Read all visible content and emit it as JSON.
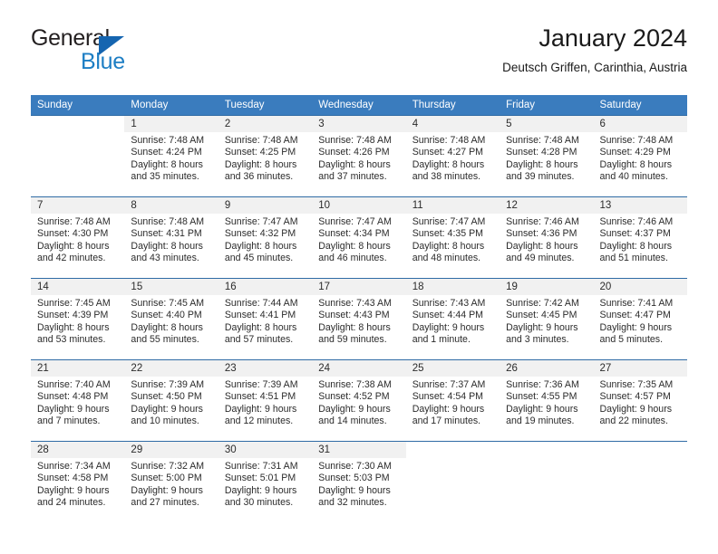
{
  "brand": {
    "name_top": "General",
    "name_bottom": "Blue",
    "triangle_color": "#1565b0",
    "blue_color": "#1d7ec4"
  },
  "header": {
    "title": "January 2024",
    "subtitle": "Deutsch Griffen, Carinthia, Austria"
  },
  "theme": {
    "header_bg": "#3a7cbe",
    "header_text": "#ffffff",
    "daynum_bg": "#f1f1f1",
    "row_border": "#2f6ba5",
    "body_text": "#2b2b2b"
  },
  "weekday_headers": [
    "Sunday",
    "Monday",
    "Tuesday",
    "Wednesday",
    "Thursday",
    "Friday",
    "Saturday"
  ],
  "labels": {
    "sunrise_prefix": "Sunrise: ",
    "sunset_prefix": "Sunset: ",
    "daylight_prefix": "Daylight: "
  },
  "weeks": [
    [
      {
        "day": "",
        "sunrise": "",
        "sunset": "",
        "daylight": ""
      },
      {
        "day": "1",
        "sunrise": "Sunrise: 7:48 AM",
        "sunset": "Sunset: 4:24 PM",
        "daylight": "Daylight: 8 hours and 35 minutes."
      },
      {
        "day": "2",
        "sunrise": "Sunrise: 7:48 AM",
        "sunset": "Sunset: 4:25 PM",
        "daylight": "Daylight: 8 hours and 36 minutes."
      },
      {
        "day": "3",
        "sunrise": "Sunrise: 7:48 AM",
        "sunset": "Sunset: 4:26 PM",
        "daylight": "Daylight: 8 hours and 37 minutes."
      },
      {
        "day": "4",
        "sunrise": "Sunrise: 7:48 AM",
        "sunset": "Sunset: 4:27 PM",
        "daylight": "Daylight: 8 hours and 38 minutes."
      },
      {
        "day": "5",
        "sunrise": "Sunrise: 7:48 AM",
        "sunset": "Sunset: 4:28 PM",
        "daylight": "Daylight: 8 hours and 39 minutes."
      },
      {
        "day": "6",
        "sunrise": "Sunrise: 7:48 AM",
        "sunset": "Sunset: 4:29 PM",
        "daylight": "Daylight: 8 hours and 40 minutes."
      }
    ],
    [
      {
        "day": "7",
        "sunrise": "Sunrise: 7:48 AM",
        "sunset": "Sunset: 4:30 PM",
        "daylight": "Daylight: 8 hours and 42 minutes."
      },
      {
        "day": "8",
        "sunrise": "Sunrise: 7:48 AM",
        "sunset": "Sunset: 4:31 PM",
        "daylight": "Daylight: 8 hours and 43 minutes."
      },
      {
        "day": "9",
        "sunrise": "Sunrise: 7:47 AM",
        "sunset": "Sunset: 4:32 PM",
        "daylight": "Daylight: 8 hours and 45 minutes."
      },
      {
        "day": "10",
        "sunrise": "Sunrise: 7:47 AM",
        "sunset": "Sunset: 4:34 PM",
        "daylight": "Daylight: 8 hours and 46 minutes."
      },
      {
        "day": "11",
        "sunrise": "Sunrise: 7:47 AM",
        "sunset": "Sunset: 4:35 PM",
        "daylight": "Daylight: 8 hours and 48 minutes."
      },
      {
        "day": "12",
        "sunrise": "Sunrise: 7:46 AM",
        "sunset": "Sunset: 4:36 PM",
        "daylight": "Daylight: 8 hours and 49 minutes."
      },
      {
        "day": "13",
        "sunrise": "Sunrise: 7:46 AM",
        "sunset": "Sunset: 4:37 PM",
        "daylight": "Daylight: 8 hours and 51 minutes."
      }
    ],
    [
      {
        "day": "14",
        "sunrise": "Sunrise: 7:45 AM",
        "sunset": "Sunset: 4:39 PM",
        "daylight": "Daylight: 8 hours and 53 minutes."
      },
      {
        "day": "15",
        "sunrise": "Sunrise: 7:45 AM",
        "sunset": "Sunset: 4:40 PM",
        "daylight": "Daylight: 8 hours and 55 minutes."
      },
      {
        "day": "16",
        "sunrise": "Sunrise: 7:44 AM",
        "sunset": "Sunset: 4:41 PM",
        "daylight": "Daylight: 8 hours and 57 minutes."
      },
      {
        "day": "17",
        "sunrise": "Sunrise: 7:43 AM",
        "sunset": "Sunset: 4:43 PM",
        "daylight": "Daylight: 8 hours and 59 minutes."
      },
      {
        "day": "18",
        "sunrise": "Sunrise: 7:43 AM",
        "sunset": "Sunset: 4:44 PM",
        "daylight": "Daylight: 9 hours and 1 minute."
      },
      {
        "day": "19",
        "sunrise": "Sunrise: 7:42 AM",
        "sunset": "Sunset: 4:45 PM",
        "daylight": "Daylight: 9 hours and 3 minutes."
      },
      {
        "day": "20",
        "sunrise": "Sunrise: 7:41 AM",
        "sunset": "Sunset: 4:47 PM",
        "daylight": "Daylight: 9 hours and 5 minutes."
      }
    ],
    [
      {
        "day": "21",
        "sunrise": "Sunrise: 7:40 AM",
        "sunset": "Sunset: 4:48 PM",
        "daylight": "Daylight: 9 hours and 7 minutes."
      },
      {
        "day": "22",
        "sunrise": "Sunrise: 7:39 AM",
        "sunset": "Sunset: 4:50 PM",
        "daylight": "Daylight: 9 hours and 10 minutes."
      },
      {
        "day": "23",
        "sunrise": "Sunrise: 7:39 AM",
        "sunset": "Sunset: 4:51 PM",
        "daylight": "Daylight: 9 hours and 12 minutes."
      },
      {
        "day": "24",
        "sunrise": "Sunrise: 7:38 AM",
        "sunset": "Sunset: 4:52 PM",
        "daylight": "Daylight: 9 hours and 14 minutes."
      },
      {
        "day": "25",
        "sunrise": "Sunrise: 7:37 AM",
        "sunset": "Sunset: 4:54 PM",
        "daylight": "Daylight: 9 hours and 17 minutes."
      },
      {
        "day": "26",
        "sunrise": "Sunrise: 7:36 AM",
        "sunset": "Sunset: 4:55 PM",
        "daylight": "Daylight: 9 hours and 19 minutes."
      },
      {
        "day": "27",
        "sunrise": "Sunrise: 7:35 AM",
        "sunset": "Sunset: 4:57 PM",
        "daylight": "Daylight: 9 hours and 22 minutes."
      }
    ],
    [
      {
        "day": "28",
        "sunrise": "Sunrise: 7:34 AM",
        "sunset": "Sunset: 4:58 PM",
        "daylight": "Daylight: 9 hours and 24 minutes."
      },
      {
        "day": "29",
        "sunrise": "Sunrise: 7:32 AM",
        "sunset": "Sunset: 5:00 PM",
        "daylight": "Daylight: 9 hours and 27 minutes."
      },
      {
        "day": "30",
        "sunrise": "Sunrise: 7:31 AM",
        "sunset": "Sunset: 5:01 PM",
        "daylight": "Daylight: 9 hours and 30 minutes."
      },
      {
        "day": "31",
        "sunrise": "Sunrise: 7:30 AM",
        "sunset": "Sunset: 5:03 PM",
        "daylight": "Daylight: 9 hours and 32 minutes."
      },
      {
        "day": "",
        "sunrise": "",
        "sunset": "",
        "daylight": ""
      },
      {
        "day": "",
        "sunrise": "",
        "sunset": "",
        "daylight": ""
      },
      {
        "day": "",
        "sunrise": "",
        "sunset": "",
        "daylight": ""
      }
    ]
  ]
}
